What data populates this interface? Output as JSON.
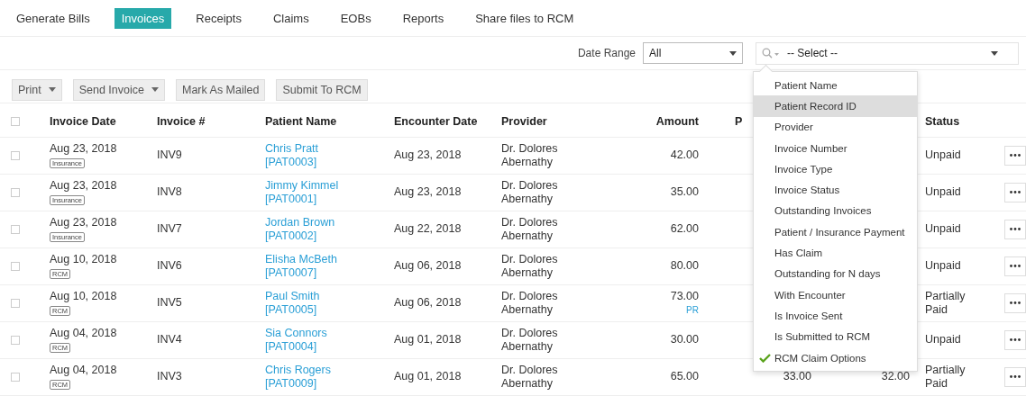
{
  "tabs": [
    {
      "label": "Generate Bills",
      "selected": false
    },
    {
      "label": "Invoices",
      "selected": true
    },
    {
      "label": "Receipts",
      "selected": false
    },
    {
      "label": "Claims",
      "selected": false
    },
    {
      "label": "EOBs",
      "selected": false
    },
    {
      "label": "Reports",
      "selected": false
    },
    {
      "label": "Share files to RCM",
      "selected": false
    }
  ],
  "filters": {
    "date_range": {
      "label": "Date Range",
      "value": "All"
    },
    "search_select": {
      "value": "-- Select --"
    }
  },
  "toolbar": [
    {
      "label": "Print",
      "kind": "dropdown"
    },
    {
      "label": "Send Invoice",
      "kind": "dropdown"
    },
    {
      "label": "Mark As Mailed",
      "kind": "button"
    },
    {
      "label": "Submit To RCM",
      "kind": "button"
    }
  ],
  "table": {
    "select_all_checked": false,
    "columns": [
      "Invoice Date",
      "Invoice #",
      "Patient Name",
      "Encounter Date",
      "Provider",
      "Amount",
      "P",
      "Status"
    ],
    "rows": [
      {
        "checked": false,
        "invoice_date": "Aug 23, 2018",
        "invoice_type": "Insurance",
        "invoice_number": "INV9",
        "patient": "Chris Pratt [PAT0003]",
        "encounter_date": "Aug 23, 2018",
        "provider": "Dr. Dolores Abernathy",
        "amount": "42.00",
        "status": "Unpaid"
      },
      {
        "checked": false,
        "invoice_date": "Aug 23, 2018",
        "invoice_type": "Insurance",
        "invoice_number": "INV8",
        "patient": "Jimmy Kimmel [PAT0001]",
        "encounter_date": "Aug 23, 2018",
        "provider": "Dr. Dolores Abernathy",
        "amount": "35.00",
        "status": "Unpaid"
      },
      {
        "checked": false,
        "invoice_date": "Aug 23, 2018",
        "invoice_type": "Insurance",
        "invoice_number": "INV7",
        "patient": "Jordan Brown [PAT0002]",
        "encounter_date": "Aug 22, 2018",
        "provider": "Dr. Dolores Abernathy",
        "amount": "62.00",
        "status": "Unpaid"
      },
      {
        "checked": false,
        "invoice_date": "Aug 10, 2018",
        "invoice_type": "RCM",
        "invoice_number": "INV6",
        "patient": "Elisha McBeth [PAT0007]",
        "encounter_date": "Aug 06, 2018",
        "provider": "Dr. Dolores Abernathy",
        "amount": "80.00",
        "status": "Unpaid"
      },
      {
        "checked": false,
        "invoice_date": "Aug 10, 2018",
        "invoice_type": "RCM",
        "invoice_number": "INV5",
        "patient": "Paul Smith [PAT0005]",
        "encounter_date": "Aug 06, 2018",
        "provider": "Dr. Dolores Abernathy",
        "amount": "73.00",
        "amount_note": "PR",
        "status": "Partially Paid"
      },
      {
        "checked": false,
        "invoice_date": "Aug 04, 2018",
        "invoice_type": "RCM",
        "invoice_number": "INV4",
        "patient": "Sia Connors [PAT0004]",
        "encounter_date": "Aug 01, 2018",
        "provider": "Dr. Dolores Abernathy",
        "amount": "30.00",
        "status": "Unpaid"
      },
      {
        "checked": false,
        "invoice_date": "Aug 04, 2018",
        "invoice_type": "RCM",
        "invoice_number": "INV3",
        "patient": "Chris Rogers [PAT0009]",
        "encounter_date": "Aug 01, 2018",
        "provider": "Dr. Dolores Abernathy",
        "amount": "65.00",
        "column_7": "33.00",
        "column_8": "32.00",
        "status": "Partially Paid"
      }
    ]
  },
  "filter_menu": {
    "items": [
      {
        "label": "Patient Name",
        "selected": false,
        "checked": false
      },
      {
        "label": "Patient Record ID",
        "selected": true,
        "checked": false
      },
      {
        "label": "Provider",
        "selected": false,
        "checked": false
      },
      {
        "label": "Invoice Number",
        "selected": false,
        "checked": false
      },
      {
        "label": "Invoice Type",
        "selected": false,
        "checked": false
      },
      {
        "label": "Invoice Status",
        "selected": false,
        "checked": false
      },
      {
        "label": "Outstanding Invoices",
        "selected": false,
        "checked": false
      },
      {
        "label": "Patient / Insurance Payment",
        "selected": false,
        "checked": false
      },
      {
        "label": "Has Claim",
        "selected": false,
        "checked": false
      },
      {
        "label": "Outstanding for N days",
        "selected": false,
        "checked": false
      },
      {
        "label": "With Encounter",
        "selected": false,
        "checked": false
      },
      {
        "label": "Is Invoice Sent",
        "selected": false,
        "checked": false
      },
      {
        "label": "Is Submitted to RCM",
        "selected": false,
        "checked": false
      },
      {
        "label": "RCM Claim Options",
        "selected": false,
        "checked": true
      }
    ]
  }
}
